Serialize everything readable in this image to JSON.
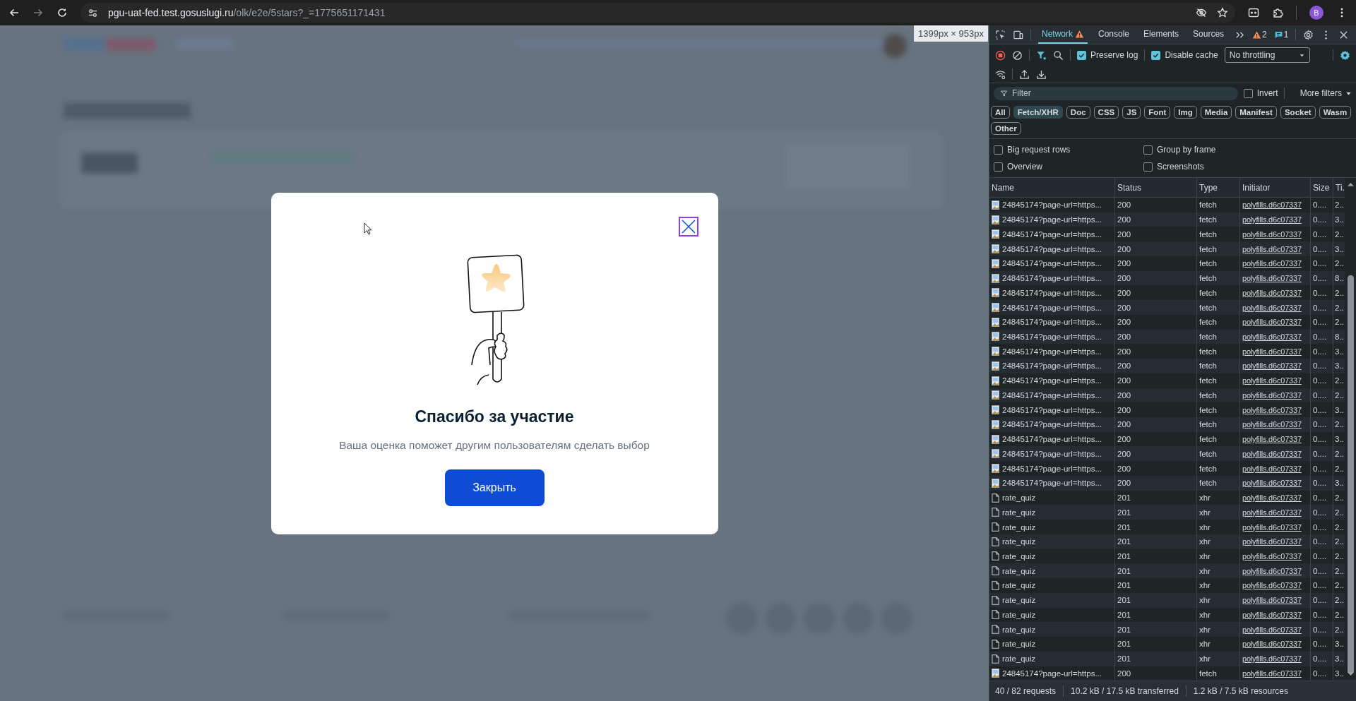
{
  "browser": {
    "url_host": "pgu-uat-fed.test.gosuslugi.ru",
    "url_path": "/olk/e2e/5stars?_=1775651171431",
    "profile_initial": "B"
  },
  "viewport_badge": "1399px × 953px",
  "dialog": {
    "title": "Спасибо за участие",
    "message": "Ваша оценка поможет другим пользователям сделать выбор",
    "button": "Закрыть"
  },
  "devtools": {
    "tabs": [
      {
        "label": "Network",
        "selected": true,
        "warning": true
      },
      {
        "label": "Console",
        "selected": false,
        "warning": false
      },
      {
        "label": "Elements",
        "selected": false,
        "warning": false
      },
      {
        "label": "Sources",
        "selected": false,
        "warning": false
      }
    ],
    "warnings_count": "2",
    "messages_count": "1",
    "recording": true,
    "preserve_log": {
      "label": "Preserve log",
      "checked": true
    },
    "disable_cache": {
      "label": "Disable cache",
      "checked": true
    },
    "throttling": "No throttling",
    "filter": {
      "placeholder": "Filter"
    },
    "invert": {
      "label": "Invert",
      "checked": false
    },
    "more_filters": "More filters",
    "type_filters": [
      {
        "label": "All",
        "selected": false
      },
      {
        "label": "Fetch/XHR",
        "selected": true
      },
      {
        "label": "Doc",
        "selected": false
      },
      {
        "label": "CSS",
        "selected": false
      },
      {
        "label": "JS",
        "selected": false
      },
      {
        "label": "Font",
        "selected": false
      },
      {
        "label": "Img",
        "selected": false
      },
      {
        "label": "Media",
        "selected": false
      },
      {
        "label": "Manifest",
        "selected": false
      },
      {
        "label": "Socket",
        "selected": false
      },
      {
        "label": "Wasm",
        "selected": false
      },
      {
        "label": "Other",
        "selected": false
      }
    ],
    "options": [
      {
        "label": "Big request rows",
        "checked": false
      },
      {
        "label": "Group by frame",
        "checked": false
      },
      {
        "label": "Overview",
        "checked": false
      },
      {
        "label": "Screenshots",
        "checked": false
      }
    ],
    "columns": [
      "Name",
      "Status",
      "Type",
      "Initiator",
      "Size",
      "Ti."
    ],
    "rows": [
      {
        "kind": "image",
        "name": "24845174?page-url=https...",
        "status": "200",
        "type": "fetch",
        "initiator": "polyfills.d6c07337",
        "size": "0....",
        "time": "2.."
      },
      {
        "kind": "image",
        "name": "24845174?page-url=https...",
        "status": "200",
        "type": "fetch",
        "initiator": "polyfills.d6c07337",
        "size": "0....",
        "time": "3.."
      },
      {
        "kind": "image",
        "name": "24845174?page-url=https...",
        "status": "200",
        "type": "fetch",
        "initiator": "polyfills.d6c07337",
        "size": "0....",
        "time": "2.."
      },
      {
        "kind": "image",
        "name": "24845174?page-url=https...",
        "status": "200",
        "type": "fetch",
        "initiator": "polyfills.d6c07337",
        "size": "0....",
        "time": "3.."
      },
      {
        "kind": "image",
        "name": "24845174?page-url=https...",
        "status": "200",
        "type": "fetch",
        "initiator": "polyfills.d6c07337",
        "size": "0....",
        "time": "2.."
      },
      {
        "kind": "image",
        "name": "24845174?page-url=https...",
        "status": "200",
        "type": "fetch",
        "initiator": "polyfills.d6c07337",
        "size": "0....",
        "time": "8.."
      },
      {
        "kind": "image",
        "name": "24845174?page-url=https...",
        "status": "200",
        "type": "fetch",
        "initiator": "polyfills.d6c07337",
        "size": "0....",
        "time": "2.."
      },
      {
        "kind": "image",
        "name": "24845174?page-url=https...",
        "status": "200",
        "type": "fetch",
        "initiator": "polyfills.d6c07337",
        "size": "0....",
        "time": "2.."
      },
      {
        "kind": "image",
        "name": "24845174?page-url=https...",
        "status": "200",
        "type": "fetch",
        "initiator": "polyfills.d6c07337",
        "size": "0....",
        "time": "2.."
      },
      {
        "kind": "image",
        "name": "24845174?page-url=https...",
        "status": "200",
        "type": "fetch",
        "initiator": "polyfills.d6c07337",
        "size": "0....",
        "time": "8.."
      },
      {
        "kind": "image",
        "name": "24845174?page-url=https...",
        "status": "200",
        "type": "fetch",
        "initiator": "polyfills.d6c07337",
        "size": "0....",
        "time": "3.."
      },
      {
        "kind": "image",
        "name": "24845174?page-url=https...",
        "status": "200",
        "type": "fetch",
        "initiator": "polyfills.d6c07337",
        "size": "0....",
        "time": "3.."
      },
      {
        "kind": "image",
        "name": "24845174?page-url=https...",
        "status": "200",
        "type": "fetch",
        "initiator": "polyfills.d6c07337",
        "size": "0....",
        "time": "2.."
      },
      {
        "kind": "image",
        "name": "24845174?page-url=https...",
        "status": "200",
        "type": "fetch",
        "initiator": "polyfills.d6c07337",
        "size": "0....",
        "time": "2.."
      },
      {
        "kind": "image",
        "name": "24845174?page-url=https...",
        "status": "200",
        "type": "fetch",
        "initiator": "polyfills.d6c07337",
        "size": "0....",
        "time": "3.."
      },
      {
        "kind": "image",
        "name": "24845174?page-url=https...",
        "status": "200",
        "type": "fetch",
        "initiator": "polyfills.d6c07337",
        "size": "0....",
        "time": "2.."
      },
      {
        "kind": "image",
        "name": "24845174?page-url=https...",
        "status": "200",
        "type": "fetch",
        "initiator": "polyfills.d6c07337",
        "size": "0....",
        "time": "3.."
      },
      {
        "kind": "image",
        "name": "24845174?page-url=https...",
        "status": "200",
        "type": "fetch",
        "initiator": "polyfills.d6c07337",
        "size": "0....",
        "time": "2.."
      },
      {
        "kind": "image",
        "name": "24845174?page-url=https...",
        "status": "200",
        "type": "fetch",
        "initiator": "polyfills.d6c07337",
        "size": "0....",
        "time": "2.."
      },
      {
        "kind": "image",
        "name": "24845174?page-url=https...",
        "status": "200",
        "type": "fetch",
        "initiator": "polyfills.d6c07337",
        "size": "0....",
        "time": "3.."
      },
      {
        "kind": "document",
        "name": "rate_quiz",
        "status": "201",
        "type": "xhr",
        "initiator": "polyfills.d6c07337",
        "size": "0....",
        "time": "2.."
      },
      {
        "kind": "document",
        "name": "rate_quiz",
        "status": "201",
        "type": "xhr",
        "initiator": "polyfills.d6c07337",
        "size": "0....",
        "time": "2.."
      },
      {
        "kind": "document",
        "name": "rate_quiz",
        "status": "201",
        "type": "xhr",
        "initiator": "polyfills.d6c07337",
        "size": "0....",
        "time": "2.."
      },
      {
        "kind": "document",
        "name": "rate_quiz",
        "status": "201",
        "type": "xhr",
        "initiator": "polyfills.d6c07337",
        "size": "0....",
        "time": "2.."
      },
      {
        "kind": "document",
        "name": "rate_quiz",
        "status": "201",
        "type": "xhr",
        "initiator": "polyfills.d6c07337",
        "size": "0....",
        "time": "2.."
      },
      {
        "kind": "document",
        "name": "rate_quiz",
        "status": "201",
        "type": "xhr",
        "initiator": "polyfills.d6c07337",
        "size": "0....",
        "time": "2.."
      },
      {
        "kind": "document",
        "name": "rate_quiz",
        "status": "201",
        "type": "xhr",
        "initiator": "polyfills.d6c07337",
        "size": "0....",
        "time": "2.."
      },
      {
        "kind": "document",
        "name": "rate_quiz",
        "status": "201",
        "type": "xhr",
        "initiator": "polyfills.d6c07337",
        "size": "0....",
        "time": "2.."
      },
      {
        "kind": "document",
        "name": "rate_quiz",
        "status": "201",
        "type": "xhr",
        "initiator": "polyfills.d6c07337",
        "size": "0....",
        "time": "2.."
      },
      {
        "kind": "document",
        "name": "rate_quiz",
        "status": "201",
        "type": "xhr",
        "initiator": "polyfills.d6c07337",
        "size": "0....",
        "time": "2.."
      },
      {
        "kind": "document",
        "name": "rate_quiz",
        "status": "201",
        "type": "xhr",
        "initiator": "polyfills.d6c07337",
        "size": "0....",
        "time": "3.."
      },
      {
        "kind": "document",
        "name": "rate_quiz",
        "status": "201",
        "type": "xhr",
        "initiator": "polyfills.d6c07337",
        "size": "0....",
        "time": "3.."
      },
      {
        "kind": "image",
        "name": "24845174?page-url=https...",
        "status": "200",
        "type": "fetch",
        "initiator": "polyfills.d6c07337",
        "size": "0....",
        "time": "3.."
      }
    ],
    "status_bar": [
      "40 / 82 requests",
      "10.2 kB / 17.5 kB transferred",
      "1.2 kB / 7.5 kB resources"
    ]
  }
}
